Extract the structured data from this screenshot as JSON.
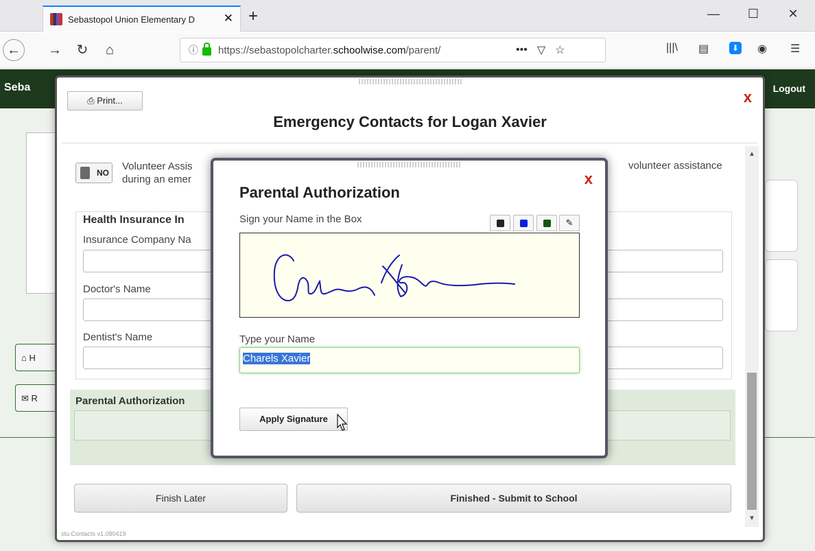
{
  "browser": {
    "tab_title": "Sebastopol Union Elementary D",
    "tab_close": "✕",
    "new_tab": "+",
    "url_prefix": "https://sebastopolcharter.",
    "url_domain": "schoolwise.com",
    "url_suffix": "/parent/",
    "url_more": "•••",
    "window_minimize": "—",
    "window_maximize": "☐",
    "window_close": "✕"
  },
  "page": {
    "brand": "Seba",
    "logout": "Logout",
    "side_home": "H",
    "side_mail": "R"
  },
  "modal": {
    "print_label": "Print...",
    "title": "Emergency Contacts for Logan Xavier",
    "close": "x",
    "volunteer_toggle": "NO",
    "volunteer_text_line1": "Volunteer Assis",
    "volunteer_text_line2": "during an emer",
    "volunteer_text_right": "volunteer assistance",
    "insurance_title": "Health Insurance In",
    "insurance_company_label": "Insurance Company Na",
    "doctor_label": "Doctor's Name",
    "dentist_label": "Dentist's Name",
    "auth_label": "Parental Authorization",
    "finish_later": "Finish Later",
    "submit": "Finished - Submit to School",
    "version": "stu.Contacts v1.080419"
  },
  "signature": {
    "title": "Parental Authorization",
    "close": "x",
    "instruction": "Sign your Name in the Box",
    "pen_colors": [
      "#222222",
      "#0022dd",
      "#0b5a0b"
    ],
    "ink_color": "#1a1aaa",
    "type_label": "Type your Name",
    "typed_name": "Charels Xavier",
    "apply_label": "Apply Signature"
  }
}
